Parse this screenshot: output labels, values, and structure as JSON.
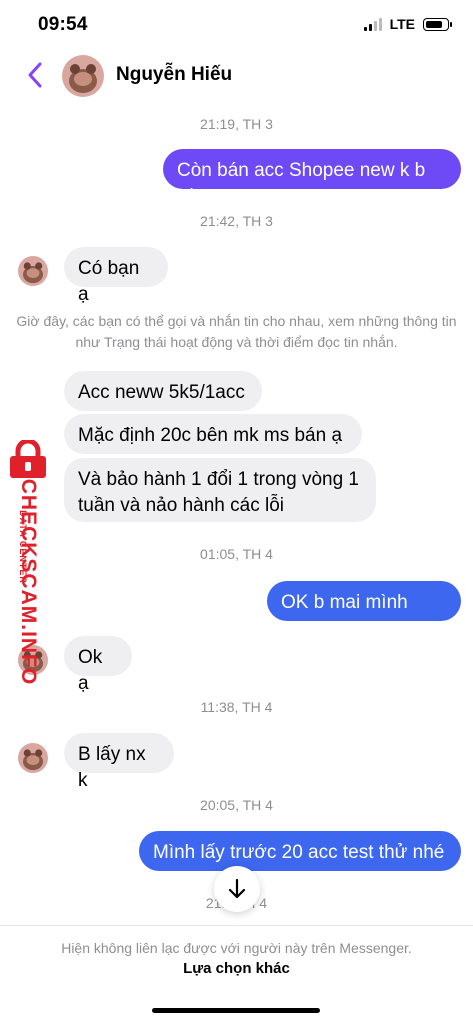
{
  "status_bar": {
    "time": "09:54",
    "network": "LTE",
    "battery_level": 0.85
  },
  "header": {
    "contact_name": "Nguyễn Hiếu",
    "back_icon": "chevron-left-icon"
  },
  "watermark": {
    "brand": "CHECKSCAM.INFO",
    "sub": "DATA CENTER"
  },
  "messages": {
    "ts1": "21:19, TH 3",
    "m1": "Còn bán acc Shopee new k b ơi",
    "ts2": "21:42, TH 3",
    "m2": "Có bạn ạ",
    "system_note": "Giờ đây, các bạn có thể gọi và nhắn tin cho nhau, xem những thông tin như Trạng thái hoạt động và thời điểm đọc tin nhắn.",
    "m3": "Acc neww 5k5/1acc",
    "m4": "Mặc định 20c bên mk ms bán ạ",
    "m5": "Và bảo hành 1 đổi 1 trong vòng 1 tuần và nảo hành các lỗi",
    "ts3": "01:05, TH 4",
    "m6": "OK b mai mình mua",
    "m7": "Ok ạ",
    "ts4": "11:38, TH 4",
    "m8": "B lấy nx k",
    "ts5": "20:05, TH 4",
    "m9": "Mình lấy trước 20 acc test thử nhé",
    "ts6": "21:0  TH 4"
  },
  "footer": {
    "note": "Hiện không liên lạc được với người này trên Messenger.",
    "action": "Lựa chọn khác"
  },
  "colors": {
    "outgoing_purple": "#6d4af6",
    "outgoing_blue": "#3c67ee",
    "incoming": "#efeff1",
    "accent": "#8a3ffc"
  }
}
